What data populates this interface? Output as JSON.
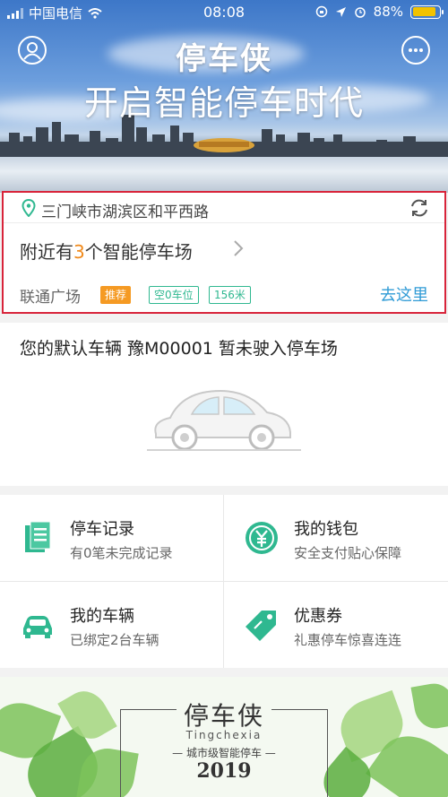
{
  "status_bar": {
    "carrier": "中国电信",
    "time": "08:08",
    "battery": "88%",
    "battery_level": 0.88
  },
  "hero": {
    "app_name": "停车侠",
    "slogan": "开启智能停车时代",
    "profile_icon": "user-icon",
    "message_icon": "chat-icon"
  },
  "location": {
    "address": "三门峡市湖滨区和平西路",
    "nearby_prefix": "附近有",
    "nearby_count": "3",
    "nearby_suffix": "个智能停车场",
    "lot_name": "联通广场",
    "badge_recommend": "推荐",
    "badge_free": "空0车位",
    "badge_distance": "156米",
    "go_label": "去这里"
  },
  "vehicle": {
    "message": "您的默认车辆 豫M00001 暂未驶入停车场"
  },
  "grid": [
    {
      "title": "停车记录",
      "desc": "有0笔未完成记录",
      "icon": "document-icon"
    },
    {
      "title": "我的钱包",
      "desc": "安全支付贴心保障",
      "icon": "yuan-icon"
    },
    {
      "title": "我的车辆",
      "desc": "已绑定2台车辆",
      "icon": "car-icon"
    },
    {
      "title": "优惠券",
      "desc": "礼惠停车惊喜连连",
      "icon": "tag-icon"
    }
  ],
  "banner": {
    "title": "停车侠",
    "english": "Tingchexia",
    "tagline": "— 城市级智能停车 —",
    "year": "2019"
  },
  "colors": {
    "accent_green": "#2fb890",
    "orange": "#f59a23",
    "link_blue": "#2f9bd6",
    "highlight_border": "#d8243a"
  }
}
